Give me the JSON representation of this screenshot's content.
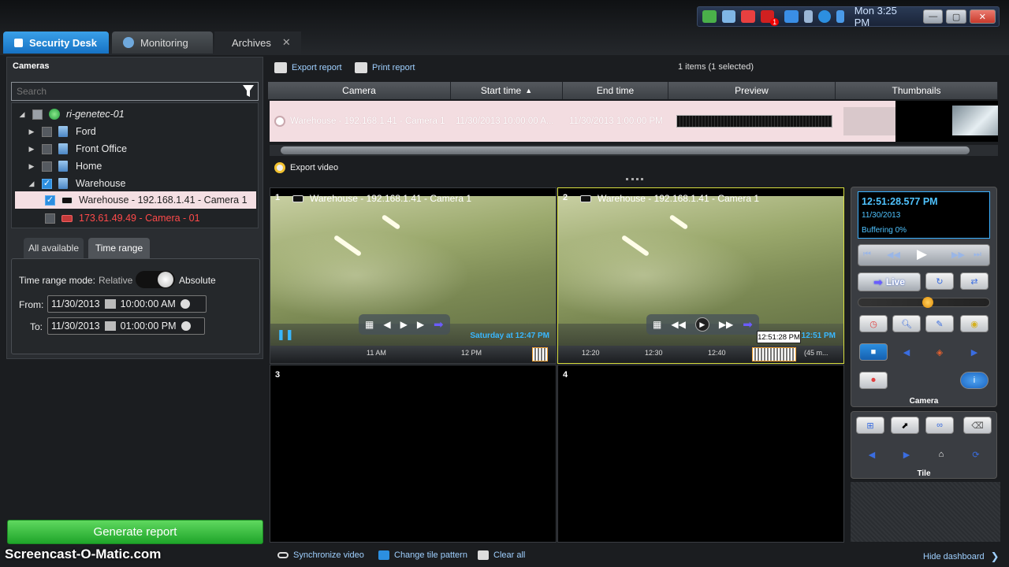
{
  "tabs": [
    {
      "label": "Security Desk"
    },
    {
      "label": "Monitoring"
    },
    {
      "label": "Archives",
      "close": "✕"
    }
  ],
  "tray": {
    "clock": "Mon 3:25 PM",
    "badge": "1"
  },
  "cameras": {
    "title": "Cameras",
    "search_placeholder": "Search",
    "tree": [
      {
        "label": "ri-genetec-01"
      },
      {
        "label": "Ford"
      },
      {
        "label": "Front Office"
      },
      {
        "label": "Home"
      },
      {
        "label": "Warehouse"
      },
      {
        "label": "Warehouse - 192.168.1.41 - Camera 1"
      },
      {
        "label": "173.61.49.49 - Camera - 01"
      }
    ]
  },
  "time_range": {
    "tabs": [
      "All available",
      "Time range"
    ],
    "mode_label": "Time range mode:",
    "relative": "Relative",
    "absolute": "Absolute",
    "from_label": "From:",
    "from_date": "11/30/2013",
    "from_time": "10:00:00 AM",
    "to_label": "To:",
    "to_date": "11/30/2013",
    "to_time": "01:00:00 PM"
  },
  "generate_report": "Generate report",
  "watermark": "Screencast-O-Matic.com",
  "report": {
    "export_report": "Export report",
    "print_report": "Print report",
    "items": "1 items (1 selected)",
    "columns": [
      "Camera",
      "Start time",
      "End time",
      "Preview",
      "Thumbnails"
    ],
    "row": {
      "camera": "Warehouse - 192.168.1.41 - Camera 1",
      "start": "11/30/2013 10:00:00 A...",
      "end": "11/30/2013 1:00:00 PM"
    },
    "export_video": "Export video"
  },
  "tiles": [
    {
      "num": "1",
      "title": "Warehouse - 192.168.1.41 - Camera 1",
      "stamp": "Saturday at 12:47 PM",
      "ticks": [
        "11 AM",
        "12 PM"
      ]
    },
    {
      "num": "2",
      "title": "Warehouse - 192.168.1.41 - Camera 1",
      "stamp": "12:51 PM",
      "ticks": [
        "12:20",
        "12:30",
        "12:40"
      ],
      "tooltip": "12:51:28 PM",
      "tail": "(45 m..."
    },
    {
      "num": "3"
    },
    {
      "num": "4"
    }
  ],
  "dashboard": {
    "time": "12:51:28.577 PM",
    "date": "11/30/2013",
    "buffering": "Buffering 0%",
    "live": "Live",
    "camera_label": "Camera",
    "tile_label": "Tile",
    "speed_fraction": 0.53
  },
  "footer": {
    "sync": "Synchronize video",
    "pattern": "Change tile pattern",
    "clear": "Clear all",
    "hide": "Hide dashboard"
  },
  "colors": {
    "accent": "#1672c4",
    "green": "#1fa52a",
    "selection": "#f3dde1",
    "blue_text": "#39b7ff"
  }
}
